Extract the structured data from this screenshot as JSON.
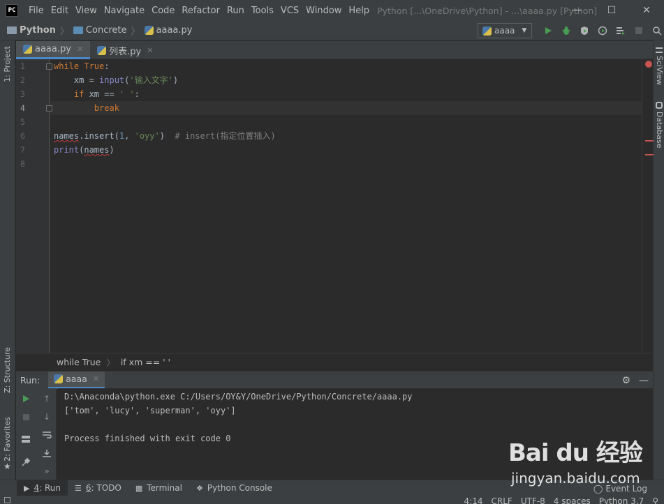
{
  "titlebar": {
    "logo": "PC",
    "menu": [
      "File",
      "Edit",
      "View",
      "Navigate",
      "Code",
      "Refactor",
      "Run",
      "Tools",
      "VCS",
      "Window",
      "Help"
    ],
    "title": "Python [...\\OneDrive\\Python] - ...\\aaaa.py [Python]"
  },
  "navbar": {
    "crumbs": [
      "Python",
      "Concrete",
      "aaaa.py"
    ],
    "run_config": "aaaa"
  },
  "left_strip": {
    "project": "1: Project",
    "structure": "Z: Structure",
    "favorites": "2: Favorites"
  },
  "right_strip": {
    "sciview": "SciView",
    "database": "Database"
  },
  "tabs": [
    {
      "label": "aaaa.py",
      "active": true
    },
    {
      "label": "列表.py",
      "active": false
    }
  ],
  "editor": {
    "line_numbers": [
      "1",
      "2",
      "3",
      "4",
      "5",
      "6",
      "7",
      "8"
    ],
    "current_line": "4",
    "code": {
      "l1_kw": "while",
      "l1_true": "True",
      "l1_colon": ":",
      "l2_pre": "    xm = ",
      "l2_fn": "input",
      "l2_open": "(",
      "l2_str": "'输入文字'",
      "l2_close": ")",
      "l3_kw": "if",
      "l3_mid": " xm == ",
      "l3_str": "' '",
      "l3_colon": ":",
      "l4_kw": "break",
      "l6_names": "names",
      "l6_call": ".insert(",
      "l6_num": "1",
      "l6_comma": ", ",
      "l6_str": "'oyy'",
      "l6_close": ")",
      "l6_cmt": "  # insert(指定位置插入)",
      "l7_fn": "print",
      "l7_open": "(",
      "l7_arg": "names",
      "l7_close": ")"
    },
    "breadcrumb": [
      "while True",
      "if xm == ' '"
    ]
  },
  "run_panel": {
    "label": "Run:",
    "tab": "aaaa",
    "output": [
      "D:\\Anaconda\\python.exe C:/Users/OY&Y/OneDrive/Python/Concrete/aaaa.py",
      "['tom', 'lucy', 'superman', 'oyy']",
      "",
      "Process finished with exit code 0"
    ]
  },
  "bottom_tools": {
    "run_num": "4",
    "run_label": ": Run",
    "todo_num": "6",
    "todo_label": ": TODO",
    "terminal": "Terminal",
    "python_console": "Python Console",
    "event_log": "Event Log"
  },
  "status": {
    "position": "4:14",
    "line_sep": "CRLF",
    "encoding": "UTF-8",
    "indent": "4 spaces",
    "interpreter": "Python 3.7"
  },
  "watermark": {
    "main": "Bai du 经验",
    "sub": "jingyan.baidu.com"
  },
  "colors": {
    "background": "#2b2b2b",
    "panel": "#3c3f41",
    "keyword": "#cc7832",
    "string": "#6a8759",
    "number": "#6897bb",
    "comment": "#808080",
    "builtin": "#8888c6",
    "run_green": "#499c54",
    "error_red": "#c75450"
  }
}
